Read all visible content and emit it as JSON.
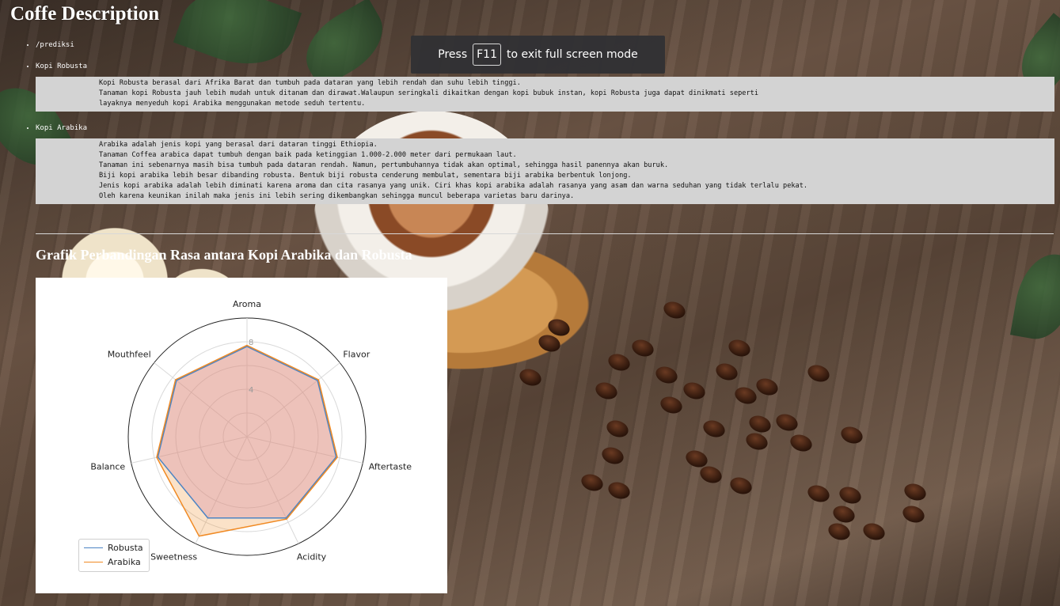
{
  "page": {
    "title": "Coffe Description"
  },
  "toast": {
    "pre": "Press",
    "key": "F11",
    "post": "to exit full screen mode"
  },
  "nav": {
    "prediksi": "/prediksi",
    "robusta": "Kopi Robusta",
    "arabika": "Kopi Arabika"
  },
  "robusta_desc": [
    "Kopi Robusta berasal dari Afrika Barat dan tumbuh pada dataran yang lebih rendah dan suhu lebih tinggi.",
    "Tanaman kopi Robusta jauh lebih mudah untuk ditanam dan dirawat.Walaupun seringkali dikaitkan dengan kopi bubuk instan, kopi Robusta juga dapat dinikmati seperti",
    "layaknya menyeduh kopi Arabika menggunakan metode seduh tertentu."
  ],
  "arabika_desc": [
    "Arabika adalah jenis kopi yang berasal dari dataran tinggi Ethiopia.",
    "Tanaman Coffea arabica dapat tumbuh dengan baik pada ketinggian 1.000-2.000 meter dari permukaan laut.",
    "Tanaman ini sebenarnya masih bisa tumbuh pada dataran rendah. Namun, pertumbuhannya tidak akan optimal, sehingga hasil panennya akan buruk.",
    "Biji kopi arabika lebih besar dibanding robusta. Bentuk biji robusta cenderung membulat, sementara biji arabika berbentuk lonjong.",
    "Jenis kopi arabika adalah lebih diminati karena aroma dan cita rasanya yang unik. Ciri khas kopi arabika adalah rasanya yang asam dan warna seduhan yang tidak terlalu pekat.",
    "Oleh karena keunikan inilah maka jenis ini lebih sering dikembangkan sehingga muncul beberapa varietas baru darinya."
  ],
  "section": {
    "title": "Grafik Perbandingan Rasa antara Kopi Arabika dan Robusta"
  },
  "chart_data": {
    "type": "radar",
    "categories": [
      "Aroma",
      "Flavor",
      "Aftertaste",
      "Acidity",
      "Sweetness",
      "Balance",
      "Mouthfeel"
    ],
    "rmax": 10,
    "rticks": [
      4,
      8
    ],
    "series": [
      {
        "name": "Robusta",
        "color": "#4c84c4",
        "values": [
          7.6,
          7.6,
          7.7,
          7.6,
          7.6,
          7.7,
          7.6
        ]
      },
      {
        "name": "Arabika",
        "color": "#f08a24",
        "values": [
          7.7,
          7.7,
          7.8,
          7.7,
          9.3,
          7.8,
          7.7
        ]
      }
    ],
    "fill_color": "#cc88cc",
    "legend_position": "lower-left",
    "grid": true
  }
}
